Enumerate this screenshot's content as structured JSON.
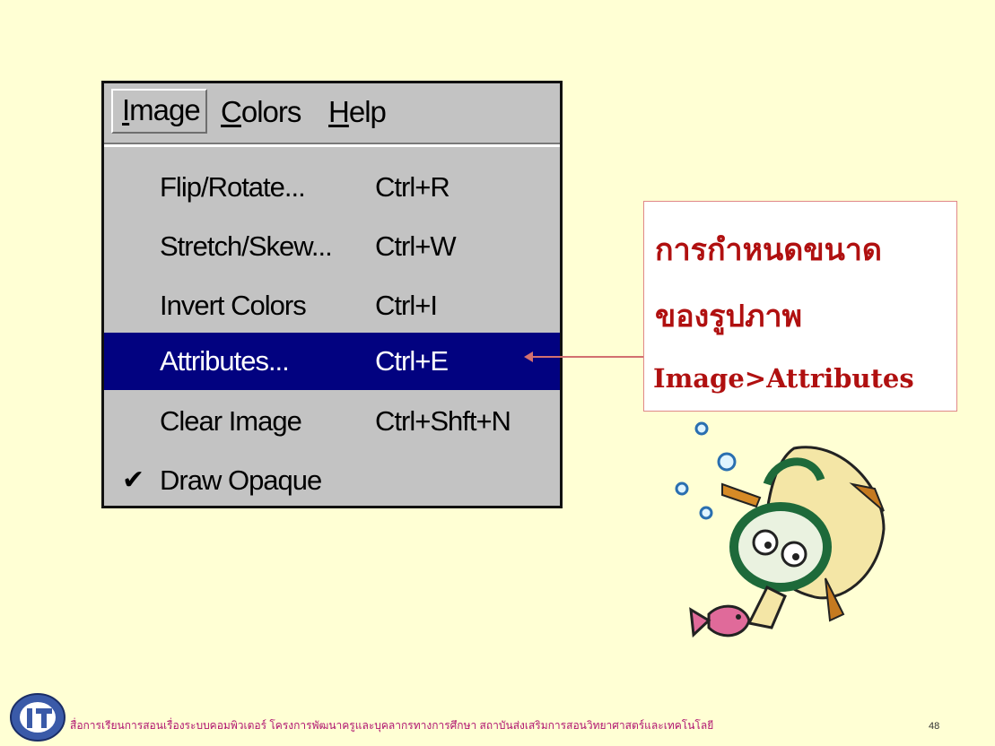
{
  "menubar": {
    "items": [
      {
        "label": "Image",
        "mnemonic": "I"
      },
      {
        "label": "Colors",
        "mnemonic": "C"
      },
      {
        "label": "Help",
        "mnemonic": "H"
      }
    ]
  },
  "menu": {
    "items": [
      {
        "label": "Flip/Rotate...",
        "shortcut": "Ctrl+R"
      },
      {
        "label": "Stretch/Skew...",
        "shortcut": "Ctrl+W"
      },
      {
        "label": "Invert Colors",
        "shortcut": "Ctrl+I"
      },
      {
        "label": "Attributes...",
        "shortcut": "Ctrl+E",
        "highlighted": true
      },
      {
        "label": "Clear Image",
        "shortcut": "Ctrl+Shft+N"
      },
      {
        "label": "Draw Opaque",
        "checked": true,
        "check_mark": "✔"
      }
    ]
  },
  "callout": {
    "line1": "การกำหนดขนาด",
    "line2": "ของรูปภาพ",
    "line3": "Image>Attributes"
  },
  "footer": {
    "text": "สื่อการเรียนการสอนเรื่องระบบคอมพิวเตอร์ โครงการพัฒนาครูและบุคลากรทางการศึกษา สถาบันส่งเสริมการสอนวิทยาศาสตร์และเทคโนโลยี",
    "page_number": "48"
  },
  "colors": {
    "background": "#ffffd4",
    "menu_bg": "#c3c3c3",
    "highlight": "#020280",
    "callout_text": "#b01010",
    "footer_text": "#b01470"
  }
}
